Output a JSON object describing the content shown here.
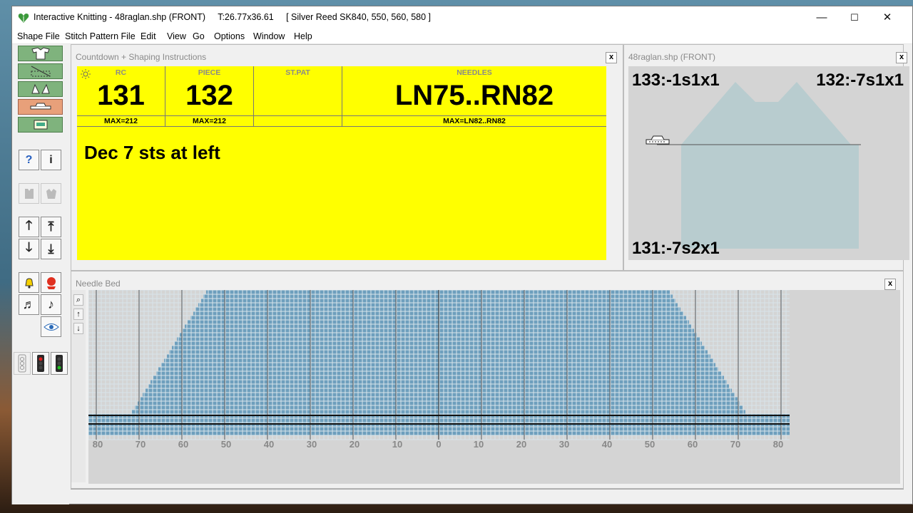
{
  "titlebar": {
    "title": "Interactive Knitting - 48raglan.shp (FRONT)     T:26.77x36.61     [ Silver Reed SK840, 550, 560, 580 ]"
  },
  "menu": [
    "Shape File",
    "Stitch Pattern File",
    "Edit",
    "View",
    "Go",
    "Options",
    "Window",
    "Help"
  ],
  "window_controls": {
    "minimize": "—",
    "maximize": "☐",
    "close": "✕"
  },
  "toolbar": {
    "help": "?",
    "info": "i",
    "up": "🡑",
    "top": "⤒",
    "down": "🡓",
    "bottom": "⤓",
    "note1": "♬",
    "note2": "♪"
  },
  "countdown": {
    "title": "Countdown + Shaping Instructions",
    "close": "x",
    "headers": {
      "rc": "RC",
      "piece": "PIECE",
      "stpat": "ST.PAT",
      "needles": "NEEDLES"
    },
    "values": {
      "rc": "131",
      "piece": "132",
      "stpat": "",
      "needles": "LN75..RN82"
    },
    "max": {
      "rc": "MAX=212",
      "piece": "MAX=212",
      "stpat": "",
      "needles": "MAX=LN82..RN82"
    },
    "instruction": "Dec 7 sts at left"
  },
  "shape": {
    "title": "48raglan.shp (FRONT)",
    "close": "x",
    "top_left": "133:-1s1x1",
    "top_right": "132:-7s1x1",
    "bottom_left": "131:-7s2x1"
  },
  "needlebed": {
    "title": "Needle Bed",
    "close": "x",
    "zoom": "⌕",
    "up": "↑",
    "down": "↓",
    "ticks": [
      "80",
      "70",
      "60",
      "50",
      "40",
      "30",
      "20",
      "10",
      "0",
      "10",
      "20",
      "30",
      "40",
      "50",
      "60",
      "70",
      "80"
    ]
  },
  "colors": {
    "yellow": "#ffff00",
    "stitch_fill": "#6e9fbd",
    "shape_fill": "#b8cccf"
  }
}
